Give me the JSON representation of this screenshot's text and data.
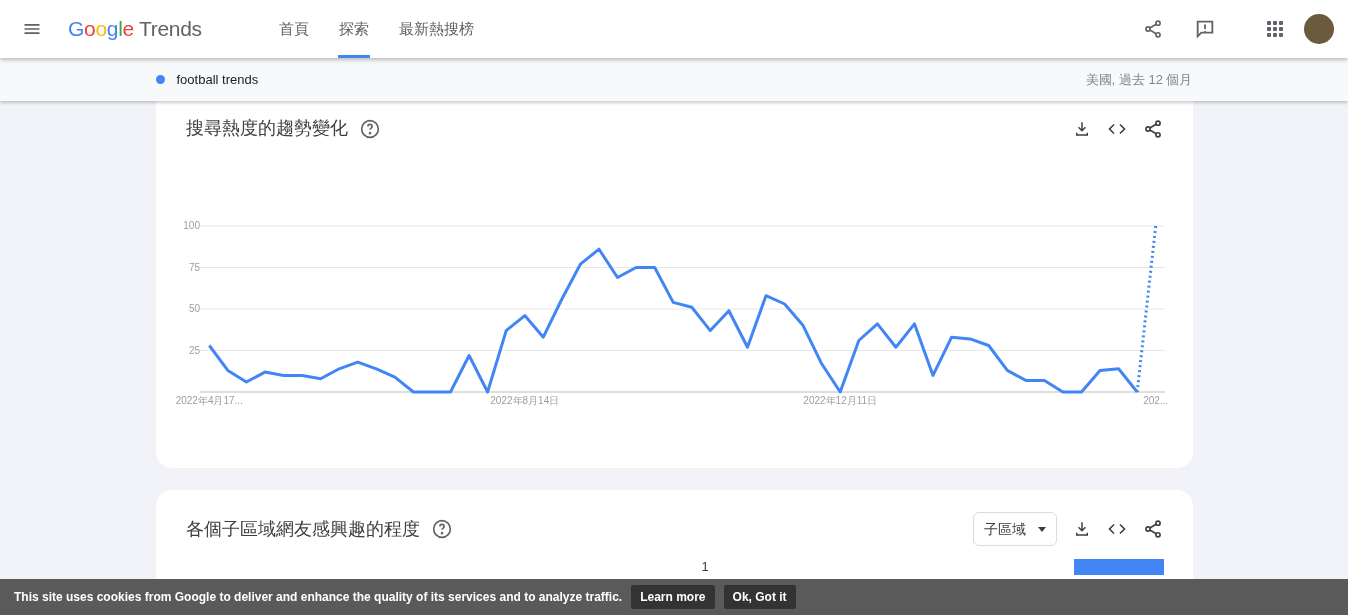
{
  "header": {
    "logo": {
      "brand": "Google",
      "product": "Trends"
    },
    "tabs": [
      {
        "label": "首頁",
        "selected": false
      },
      {
        "label": "探索",
        "selected": true
      },
      {
        "label": "最新熱搜榜",
        "selected": false
      }
    ]
  },
  "query_bar": {
    "term": {
      "label": "football trends",
      "color": "#4285f4"
    },
    "scope": "美國, 過去 12 個月"
  },
  "interest_over_time": {
    "title": "搜尋熱度的趨勢變化",
    "chart_data": {
      "type": "line",
      "ylim": [
        0,
        100
      ],
      "yticks": [
        25,
        50,
        75,
        100
      ],
      "grid": true,
      "categories": [
        "2022年4月17...",
        null,
        null,
        null,
        null,
        null,
        null,
        null,
        null,
        null,
        null,
        null,
        null,
        null,
        null,
        null,
        null,
        "2022年8月14日",
        null,
        null,
        null,
        null,
        null,
        null,
        null,
        null,
        null,
        null,
        null,
        null,
        null,
        null,
        null,
        null,
        "2022年12月11日",
        null,
        null,
        null,
        null,
        null,
        null,
        null,
        null,
        null,
        null,
        null,
        null,
        null,
        null,
        null,
        null,
        "202..."
      ],
      "series": [
        {
          "color": "#4285f4",
          "line_style": "solid",
          "values": [
            28,
            13,
            6,
            12,
            10,
            10,
            8,
            14,
            18,
            14,
            9,
            0,
            0,
            0,
            22,
            0,
            37,
            46,
            33,
            56,
            77,
            86,
            69,
            75,
            75,
            54,
            51,
            37,
            49,
            27,
            58,
            53,
            40,
            17,
            0,
            31,
            41,
            27,
            41,
            10,
            33,
            32,
            28,
            13,
            7,
            7,
            0,
            0,
            13,
            14,
            0,
            null
          ]
        },
        {
          "color": "#4285f4",
          "line_style": "dotted",
          "values": [
            null,
            null,
            null,
            null,
            null,
            null,
            null,
            null,
            null,
            null,
            null,
            null,
            null,
            null,
            null,
            null,
            null,
            null,
            null,
            null,
            null,
            null,
            null,
            null,
            null,
            null,
            null,
            null,
            null,
            null,
            null,
            null,
            null,
            null,
            null,
            null,
            null,
            null,
            null,
            null,
            null,
            null,
            null,
            null,
            null,
            null,
            null,
            null,
            null,
            null,
            0,
            100
          ]
        }
      ]
    }
  },
  "interest_by_subregion": {
    "title": "各個子區域網友感興趣的程度",
    "dropdown": "子區域",
    "rows": [
      {
        "rank": "1",
        "level": 1
      }
    ]
  },
  "cookie_banner": {
    "text": "This site uses cookies from Google to deliver and enhance the quality of its services and to analyze traffic.",
    "buttons": [
      "Learn more",
      "Ok, Got it"
    ]
  }
}
